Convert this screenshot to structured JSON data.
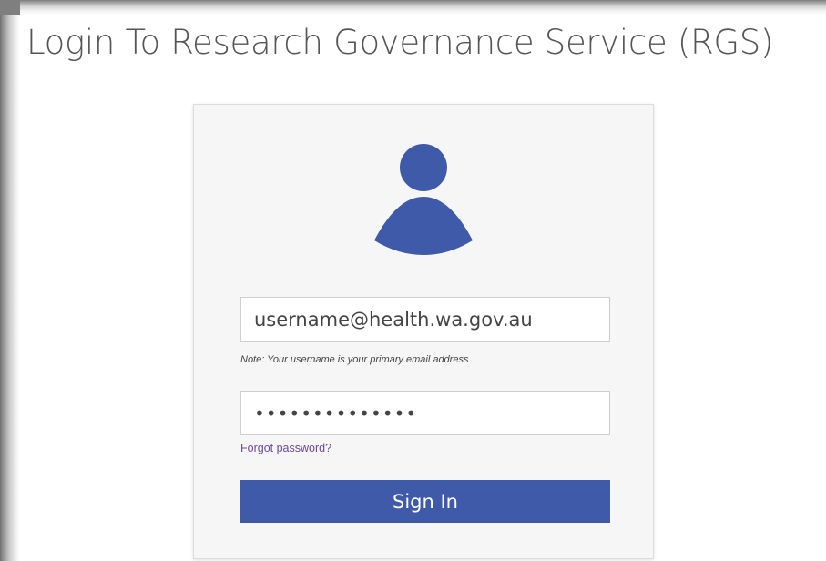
{
  "page": {
    "title": "Login To Research Governance Service (RGS)"
  },
  "login": {
    "avatar_icon": "user-silhouette-icon",
    "accent_color": "#3f5aa9",
    "username": {
      "value": "username@health.wa.gov.au",
      "note": "Note: Your username is your primary email address"
    },
    "password": {
      "value": "••••••••••••••"
    },
    "forgot_password_label": "Forgot password?",
    "sign_in_label": "Sign In"
  }
}
